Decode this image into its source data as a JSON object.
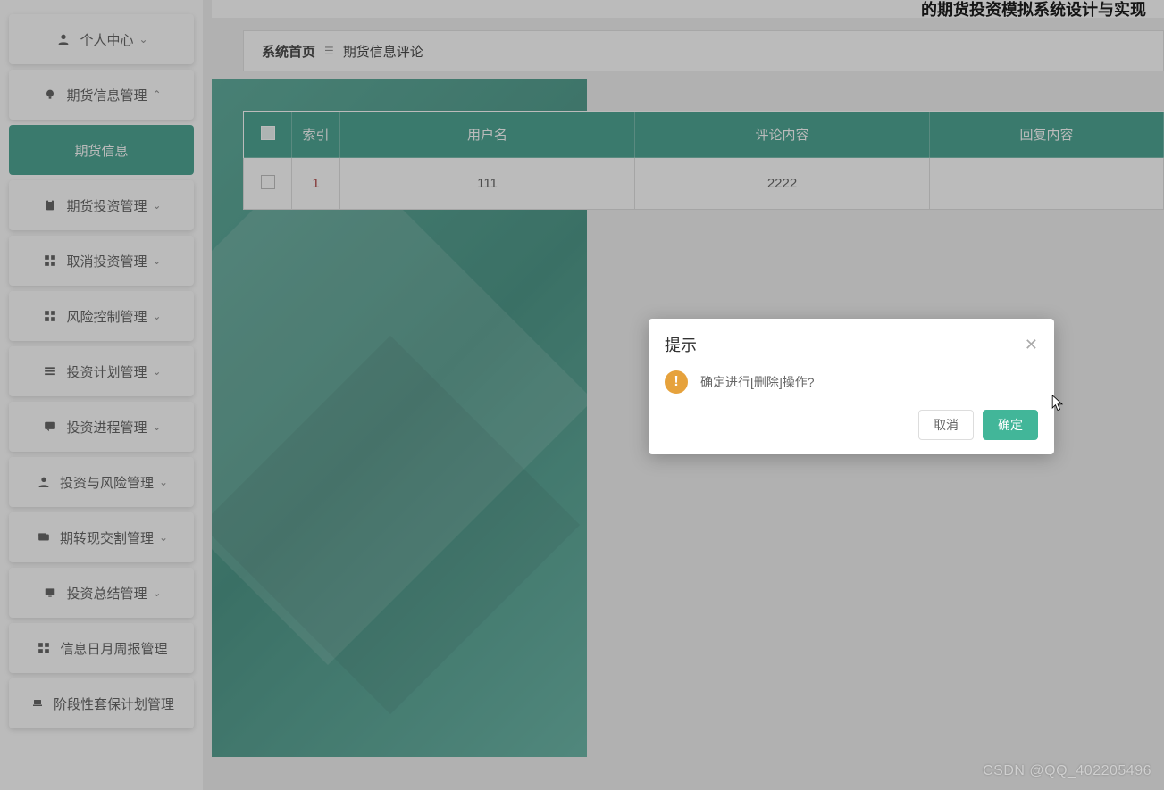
{
  "header": {
    "title_fragment": "的期货投资模拟系统设计与实现"
  },
  "breadcrumb": {
    "home": "系统首页",
    "current": "期货信息评论"
  },
  "sidebar": {
    "items": [
      {
        "icon": "user-icon",
        "label": "个人中心",
        "chev": "down"
      },
      {
        "icon": "bulb-icon",
        "label": "期货信息管理",
        "chev": "up"
      },
      {
        "icon": "",
        "label": "期货信息",
        "active": true
      },
      {
        "icon": "clipboard-icon",
        "label": "期货投资管理",
        "chev": "down"
      },
      {
        "icon": "grid-icon",
        "label": "取消投资管理",
        "chev": "down"
      },
      {
        "icon": "grid-icon",
        "label": "风险控制管理",
        "chev": "down"
      },
      {
        "icon": "list-icon",
        "label": "投资计划管理",
        "chev": "down"
      },
      {
        "icon": "chat-icon",
        "label": "投资进程管理",
        "chev": "down"
      },
      {
        "icon": "user-icon",
        "label": "投资与风险管理",
        "chev": "down"
      },
      {
        "icon": "wallet-icon",
        "label": "期转现交割管理",
        "chev": "down"
      },
      {
        "icon": "monitor-icon",
        "label": "投资总结管理",
        "chev": "down"
      },
      {
        "icon": "grid-icon",
        "label": "信息日月周报管理",
        "chev": ""
      },
      {
        "icon": "laptop-icon",
        "label": "阶段性套保计划管理",
        "chev": ""
      }
    ]
  },
  "table": {
    "headers": {
      "index": "索引",
      "user": "用户名",
      "comment": "评论内容",
      "reply": "回复内容"
    },
    "rows": [
      {
        "index": "1",
        "user": "111",
        "comment": "2222",
        "reply": ""
      }
    ]
  },
  "dialog": {
    "title": "提示",
    "message": "确定进行[删除]操作?",
    "cancel": "取消",
    "ok": "确定"
  },
  "watermark": "CSDN @QQ_402205496",
  "colors": {
    "primary": "#3a9b87",
    "ok": "#42b699",
    "warn": "#e6a23c"
  }
}
